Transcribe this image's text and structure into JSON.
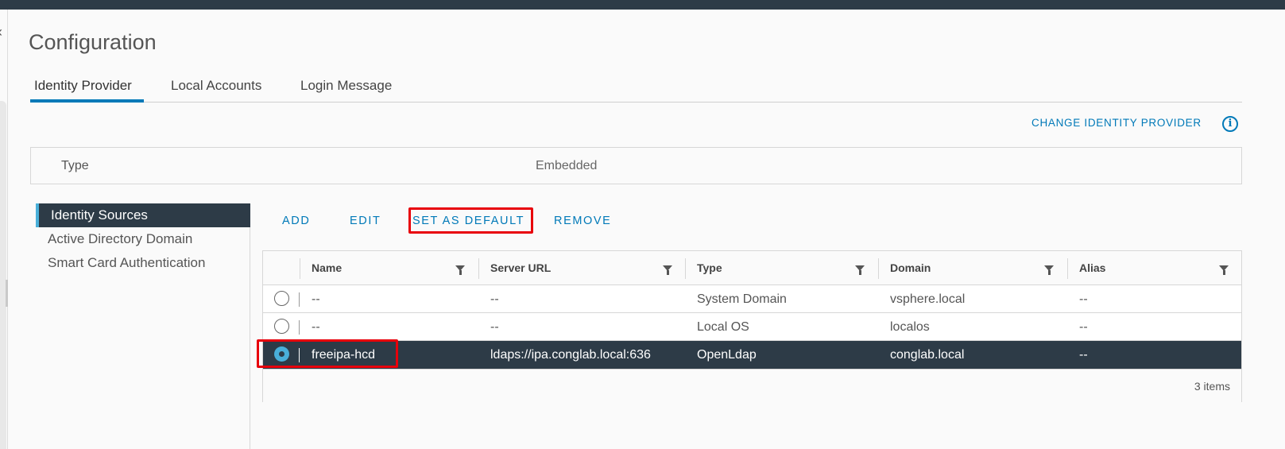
{
  "page": {
    "title": "Configuration"
  },
  "tabs": [
    {
      "label": "Identity Provider",
      "active": true
    },
    {
      "label": "Local Accounts",
      "active": false
    },
    {
      "label": "Login Message",
      "active": false
    }
  ],
  "header_actions": {
    "change_provider": "CHANGE IDENTITY PROVIDER",
    "info_icon": "info-icon"
  },
  "provider_type": {
    "label": "Type",
    "value": "Embedded"
  },
  "sidenav": {
    "items": [
      {
        "label": "Identity Sources",
        "active": true
      },
      {
        "label": "Active Directory Domain",
        "active": false
      },
      {
        "label": "Smart Card Authentication",
        "active": false
      }
    ]
  },
  "toolbar": {
    "add": "ADD",
    "edit": "EDIT",
    "set_default": "SET AS DEFAULT",
    "remove": "REMOVE"
  },
  "grid": {
    "columns": [
      "Name",
      "Server URL",
      "Type",
      "Domain",
      "Alias"
    ],
    "rows": [
      {
        "selected": false,
        "name": "--",
        "server_url": "--",
        "type": "System Domain",
        "domain": "vsphere.local",
        "alias": "--"
      },
      {
        "selected": false,
        "name": "--",
        "server_url": "--",
        "type": "Local OS",
        "domain": "localos",
        "alias": "--"
      },
      {
        "selected": true,
        "name": "freeipa-hcd",
        "server_url": "ldaps://ipa.conglab.local:636",
        "type": "OpenLdap",
        "domain": "conglab.local",
        "alias": "--"
      }
    ],
    "footer": "3 items"
  },
  "colors": {
    "accent": "#0079b8",
    "selected_row": "#2d3b47",
    "highlight_box": "#e8000b"
  }
}
